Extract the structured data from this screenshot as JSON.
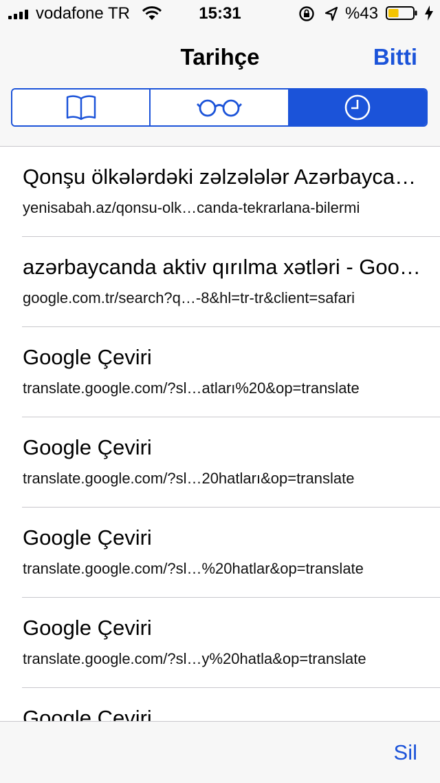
{
  "status_bar": {
    "carrier": "vodafone TR",
    "time": "15:31",
    "battery_percent": "%43",
    "battery_level": 0.43,
    "battery_color": "#f5c400",
    "icons": [
      "signal-icon",
      "wifi-icon",
      "rotation-lock-icon",
      "location-icon",
      "battery-icon",
      "charging-bolt-icon"
    ]
  },
  "nav": {
    "title": "Tarihçe",
    "done_label": "Bitti",
    "accent_color": "#1b53d9",
    "segments": [
      {
        "icon": "book-icon",
        "active": false
      },
      {
        "icon": "glasses-icon",
        "active": false
      },
      {
        "icon": "clock-icon",
        "active": true
      }
    ]
  },
  "history": [
    {
      "title": "Qonşu ölkələrdəki zəlzələlər Azərbaycanda təkrarlana bilərmi",
      "url": "yenisabah.az/qonsu-olk…canda-tekrarlana-bilermi"
    },
    {
      "title": "azərbaycanda aktiv qırılma xətləri - Google'da Ara",
      "url": "google.com.tr/search?q…-8&hl=tr-tr&client=safari"
    },
    {
      "title": "Google Çeviri",
      "url": "translate.google.com/?sl…atları%20&op=translate"
    },
    {
      "title": "Google Çeviri",
      "url": "translate.google.com/?sl…20hatları&op=translate"
    },
    {
      "title": "Google Çeviri",
      "url": "translate.google.com/?sl…%20hatlar&op=translate"
    },
    {
      "title": "Google Çeviri",
      "url": "translate.google.com/?sl…y%20hatla&op=translate"
    },
    {
      "title": "Google Çeviri",
      "url": ""
    }
  ],
  "toolbar": {
    "delete_label": "Sil"
  }
}
